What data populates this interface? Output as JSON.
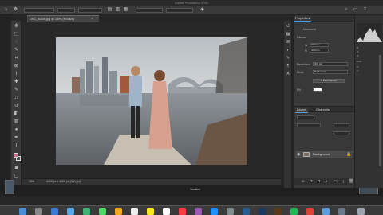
{
  "app": {
    "title": "Adobe Photoshop 2020"
  },
  "document": {
    "tab_title": "DSC_6108.jpg @ 25% (RGB/8)",
    "zoom": "25%",
    "status": "6000 px x 4000 px (300 ppi)"
  },
  "timeline": {
    "label": "Timeline"
  },
  "properties_panel": {
    "tabs": [
      "Properties"
    ],
    "document_label": "Document",
    "canvas_label": "Canvas",
    "width_label": "W",
    "width_value": "6000 px",
    "height_label": "H",
    "height_value": "4000 px",
    "resolution_label": "Resolution",
    "resolution_value": "300 ppi",
    "mode_label": "Mode",
    "mode_value": "RGB Color",
    "depth_value": "8 Bits/Channel",
    "fill_label": "Fill"
  },
  "layers_panel": {
    "tabs": [
      "Layers",
      "Channels"
    ],
    "layer_name": "Background"
  },
  "info_panel": {
    "lines": [
      "R:",
      "G:",
      "B:",
      "8-bit",
      "X:",
      "Y:"
    ]
  },
  "colors": {
    "accent": "#5b9bd5",
    "foreground_swatch": "#c96b8b"
  },
  "icons": {
    "move": "move-icon",
    "home": "home-icon"
  }
}
